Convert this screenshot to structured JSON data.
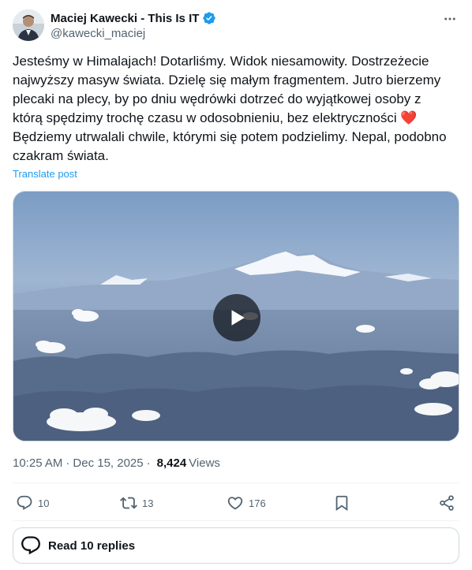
{
  "author": {
    "name": "Maciej Kawecki - This Is IT",
    "handle": "@kawecki_maciej",
    "verified": true,
    "verified_color": "#1d9bf0"
  },
  "post": {
    "text": "Jesteśmy w Himalajach! Dotarliśmy. Widok niesamowity. Dostrzeżecie najwyższy masyw świata. Dzielę się małym fragmentem. Jutro bierzemy plecaki na plecy, by po dniu wędrówki dotrzeć do wyjątkowej osoby z którą spędzimy trochę czasu w odosobnieniu, bez elektryczności",
    "emoji": "❤️",
    "text_after": "Będziemy utrwalali chwile, którymi się potem podzielimy. Nepal, podobno czakram świata.",
    "translate_label": "Translate post"
  },
  "media": {
    "type": "video",
    "play_icon": "play-icon"
  },
  "meta": {
    "time": "10:25 AM",
    "separator": "·",
    "date": "Dec 15, 2025",
    "views_count": "8,424",
    "views_label": "Views"
  },
  "actions": {
    "replies": "10",
    "reposts": "13",
    "likes": "176",
    "icons": [
      "reply-icon",
      "repost-icon",
      "like-icon",
      "bookmark-icon",
      "share-icon"
    ]
  },
  "read_replies": {
    "label": "Read 10 replies"
  },
  "colors": {
    "text": "#0f1419",
    "secondary": "#536471",
    "accent": "#1d9bf0",
    "border": "#cfd9de"
  }
}
